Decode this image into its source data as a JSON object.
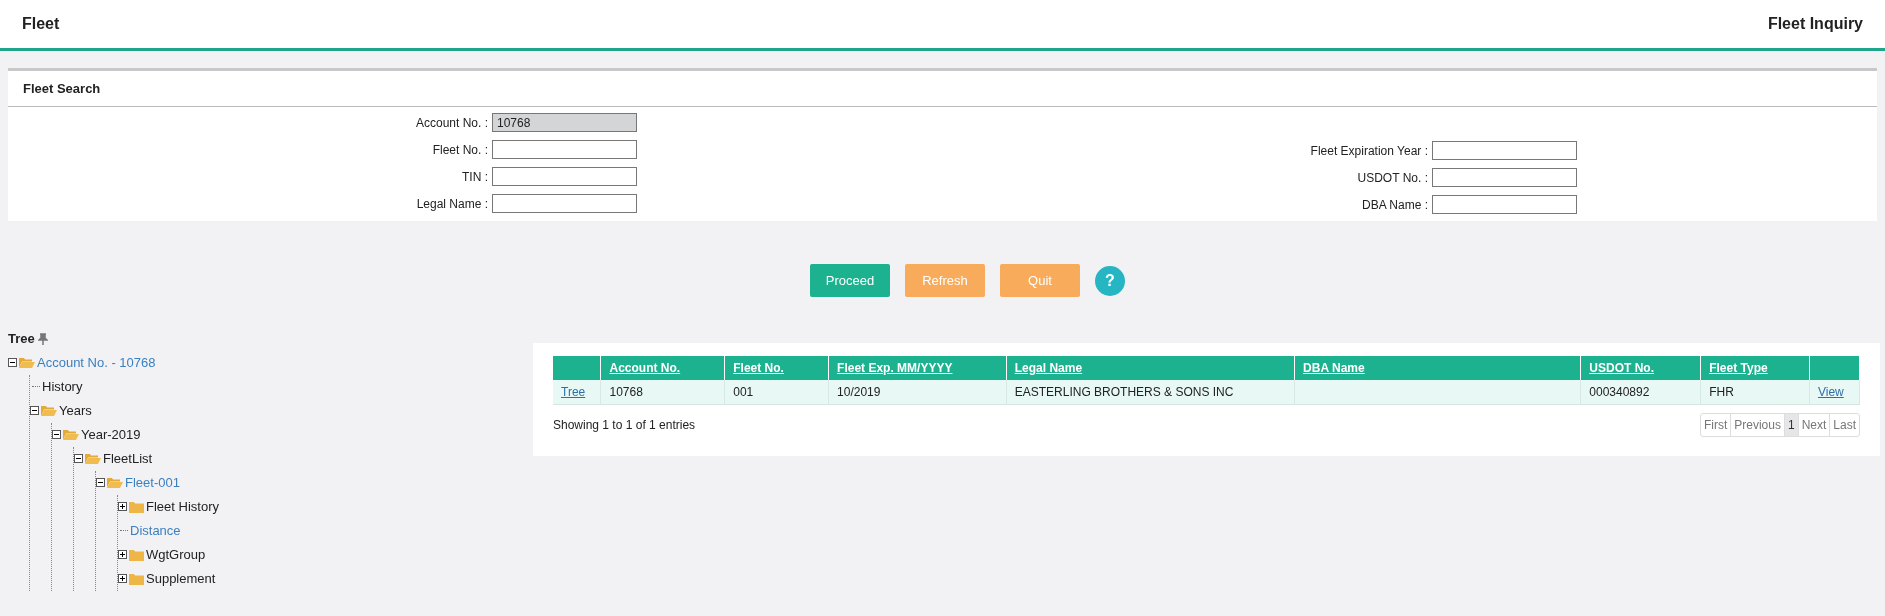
{
  "header": {
    "title": "Fleet",
    "page_title": "Fleet Inquiry"
  },
  "search_panel": {
    "title": "Fleet Search",
    "left_fields": [
      {
        "label": "Account No. :",
        "value": "10768",
        "disabled": true
      },
      {
        "label": "Fleet No. :",
        "disabled": false
      },
      {
        "label": "TIN :",
        "disabled": false
      },
      {
        "label": "Legal Name :",
        "disabled": false
      }
    ],
    "right_fields": [
      {
        "label": "Fleet Expiration Year :",
        "disabled": false
      },
      {
        "label": "USDOT No. :",
        "disabled": false
      },
      {
        "label": "DBA Name :",
        "disabled": false
      }
    ]
  },
  "buttons": [
    {
      "label": "Proceed",
      "kind": "primary"
    },
    {
      "label": "Refresh",
      "kind": "warning"
    },
    {
      "label": "Quit",
      "kind": "warning"
    },
    {
      "label": "?",
      "kind": "help"
    }
  ],
  "tree": {
    "title": "Tree",
    "items": [
      {
        "label": "Account No. - 10768",
        "kind": "folder",
        "expanded": true,
        "link": true,
        "children": [
          {
            "label": "History",
            "kind": "leaf",
            "link": false
          },
          {
            "label": "Years",
            "kind": "folder",
            "expanded": true,
            "link": false,
            "children": [
              {
                "label": "Year-2019",
                "kind": "folder",
                "expanded": true,
                "link": false,
                "children": [
                  {
                    "label": "FleetList",
                    "kind": "folder",
                    "expanded": true,
                    "link": false,
                    "children": [
                      {
                        "label": "Fleet-001",
                        "kind": "folder",
                        "expanded": true,
                        "link": true,
                        "children": [
                          {
                            "label": "Fleet History",
                            "kind": "folder",
                            "expanded": false,
                            "link": false
                          },
                          {
                            "label": "Distance",
                            "kind": "leaf",
                            "link": true
                          },
                          {
                            "label": "WgtGroup",
                            "kind": "folder",
                            "expanded": false,
                            "link": false
                          },
                          {
                            "label": "Supplement",
                            "kind": "folder",
                            "expanded": false,
                            "link": false
                          }
                        ]
                      }
                    ]
                  }
                ]
              }
            ]
          }
        ]
      }
    ]
  },
  "table": {
    "columns": [
      "",
      "Account No.",
      "Fleet No.",
      "Fleet Exp. MM/YYYY",
      "Legal Name",
      "DBA Name",
      "USDOT No.",
      "Fleet Type",
      ""
    ],
    "rows": [
      {
        "cells": [
          {
            "kind": "link",
            "text": "Tree"
          },
          {
            "kind": "text",
            "text": "10768"
          },
          {
            "kind": "text",
            "text": "001"
          },
          {
            "kind": "text",
            "text": "10/2019"
          },
          {
            "kind": "text",
            "text": "EASTERLING BROTHERS & SONS INC"
          },
          {
            "kind": "text",
            "text": ""
          },
          {
            "kind": "text",
            "text": "000340892"
          },
          {
            "kind": "text",
            "text": "FHR"
          },
          {
            "kind": "link",
            "text": "View"
          }
        ]
      }
    ],
    "info": "Showing 1 to 1 of 1 entries",
    "pagination": [
      {
        "label": "First",
        "selected": false
      },
      {
        "label": "Previous",
        "selected": false
      },
      {
        "label": "1",
        "selected": true
      },
      {
        "label": "Next",
        "selected": false
      },
      {
        "label": "Last",
        "selected": false
      }
    ]
  }
}
